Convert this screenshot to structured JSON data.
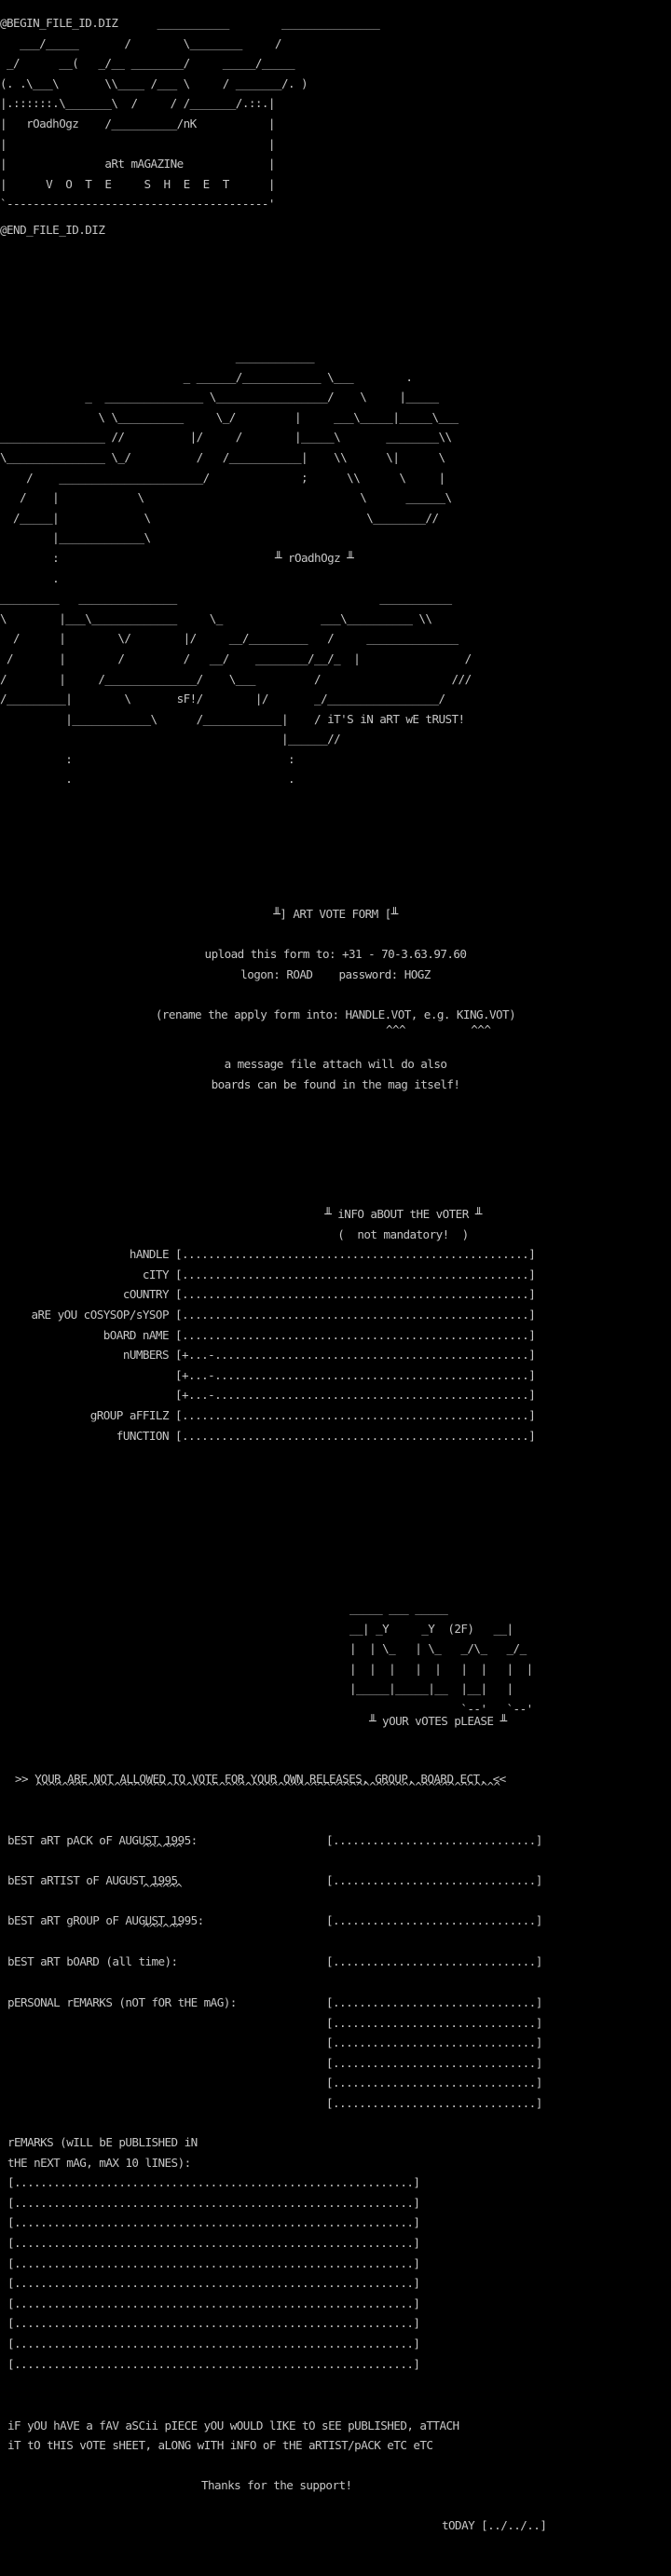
{
  "header": {
    "begin_tag": "@BEGIN_FILE_ID.DIZ",
    "end_tag": "@END_FILE_ID.DIZ",
    "logo_art": [
      "@BEGIN_FILE_ID.DIZ      ___________        _______________",
      "   ___/_____       /        \\________     /",
      " _/      __(   _/__ ________/     _____/_____",
      "(. .\\___\\       \\\\____ /___ \\     / _______/. )",
      "|.::::::.\\_______\\  /     / /_______/.::.|",
      "|   rOadhOgz    /__________/nK           |",
      "|                                        |",
      "|               aRt mAGAZINe             |",
      "|      V  O  T  E     S  H  E  E  T      |",
      "`----------------------------------------'"
    ]
  },
  "logo_block": {
    "lines": [
      "                                    ____________",
      "                            _ ______/____________ \\___        .",
      "             _  _______________ \\_________________/    \\     |_____",
      "               \\ \\__________     \\_/         |     ___\\_____|_____\\___",
      "________________ //          |/     /        |_____\\       ________\\\\",
      "\\_______________ \\_/          /   /___________|    \\\\      \\|      \\",
      "    /    ______________________/              ;      \\\\      \\     |",
      "   /    |            \\                                 \\      ______\\",
      "  /_____|             \\                                 \\________//",
      "        |_____________\\",
      "        :                                 ╨ rOadhOgz ╨",
      "        .",
      "_________   _______________                               ___________",
      "\\        |___\\_____________     \\_               ___\\__________ \\\\",
      "  /      |        \\/        |/     __/_________   /     ______________",
      " /       |        /         /   __/    ________/__/_  |                /",
      "/        |     /______________/    \\___         /                    ///",
      "/_________|        \\       sF!/        |/       _/_________________/",
      "          |____________\\      /____________|    / iT'S iN aRT wE tRUST!",
      "                                           |______//",
      "          :                                 :",
      "          .                                 ."
    ]
  },
  "vote_form_intro": {
    "title": "╨] ART VOTE FORM [╨",
    "upload_line": "upload this form to: +31 - 70-3.63.97.60",
    "logon_line": "logon: ROAD    password: HOGZ",
    "rename_line": "(rename the apply form into: HANDLE.VOT, e.g. KING.VOT)",
    "rename_carets": "^^^          ^^^",
    "attach_line_1": "a message file attach will do also",
    "attach_line_2": "boards can be found in the mag itself!"
  },
  "voter_info": {
    "title": "╨ iNFO aBOUT tHE vOTER ╨",
    "subtitle": "(  not mandatory!  )",
    "fields": [
      {
        "label": "hANDLE",
        "value": "[.....................................................]"
      },
      {
        "label": "cITY",
        "value": "[.....................................................]"
      },
      {
        "label": "cOUNTRY",
        "value": "[.....................................................]"
      },
      {
        "label": "aRE yOU cOSYSOP/sYSOP",
        "value": "[.....................................................]"
      },
      {
        "label": "bOARD nAME",
        "value": "[.....................................................]"
      },
      {
        "label": "nUMBERS",
        "value": "[+...-................................................]"
      },
      {
        "label": "",
        "value": "[+...-................................................]"
      },
      {
        "label": "",
        "value": "[+...-................................................]"
      },
      {
        "label": "gROUP aFFILZ",
        "value": "[.....................................................]"
      },
      {
        "label": "fUNCTION",
        "value": "[.....................................................]"
      }
    ]
  },
  "votes_block": {
    "logo_lines": [
      "_____ ___ _____",
      "__| _Y     _Y  (2F)   __|",
      "|  | \\_   | \\_   _/\\_   _/_",
      "|  |  |   |  |   |  |   |  |",
      "|_____|_____|__  |__|   |",
      "                 `--'   `--'"
    ],
    "title": "╨ yOUR vOTES pLEASE ╨",
    "warning": ">> YOUR ARE NOT ALLOWED TO VOTE FOR YOUR OWN RELEASES, GROUP, BOARD ECT. <<",
    "warning_underline": "^^^^^^^^^^^^^^^^^^^^^^^^^^^^^^^^^^^^^^^^^^^^^^^^^^^^^^^^^^^^^^^^^^^^^^^",
    "categories": [
      {
        "label": "bEST aRT pACK oF AUGUST 1995:",
        "carets": "^^^^^^",
        "slot": "[...............................]"
      },
      {
        "label": "bEST aRTIST oF AUGUST 1995",
        "carets": "^^^^^^",
        "slot": "[...............................]"
      },
      {
        "label": "bEST aRT gROUP oF AUGUST 1995:",
        "carets": "^^^^^^",
        "slot": "[...............................]"
      },
      {
        "label": "bEST aRT bOARD (all time):",
        "carets": "",
        "slot": "[...............................]"
      }
    ],
    "personal_remarks_label": "pERSONAL rEMARKS (nOT fOR tHE mAG):",
    "personal_remarks_slots": [
      "[...............................]",
      "[...............................]",
      "[...............................]",
      "[...............................]",
      "[...............................]",
      "[...............................]"
    ],
    "published_remarks_label_1": "rEMARKS (wILL bE pUBLISHED iN",
    "published_remarks_label_2": "tHE nEXT mAG, mAX 10 lINES):",
    "published_remarks_slots": [
      "[.............................................................]",
      "[.............................................................]",
      "[.............................................................]",
      "[.............................................................]",
      "[.............................................................]",
      "[.............................................................]",
      "[.............................................................]",
      "[.............................................................]",
      "[.............................................................]",
      "[.............................................................]"
    ]
  },
  "footer": {
    "attach_line_1": "iF yOU hAVE a fAV aSCii pIECE yOU wOULD lIKE tO sEE pUBLISHED, aTTACH",
    "attach_line_2": "iT tO tHIS vOTE sHEET, aLONG wITH iNFO oF tHE aRTIST/pACK eTC eTC",
    "thanks": "Thanks for the support!",
    "today": "tODAY [../../..]"
  }
}
